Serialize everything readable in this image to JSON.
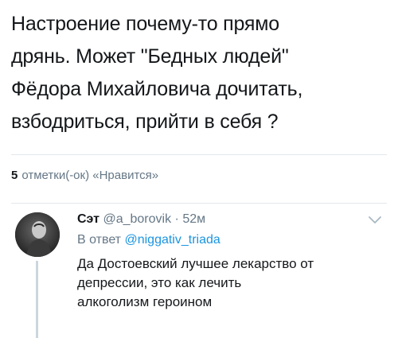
{
  "tweet": {
    "text_lines": [
      "Настроение почему-то прямо",
      "дрянь. Может \"Бедных людей\"",
      "Фёдора Михайловича дочитать,",
      "взбодриться, прийти в себя ?"
    ],
    "likes_count": "5",
    "likes_label": "отметки(-ок) «Нравится»"
  },
  "reply": {
    "author_name": "Сэт",
    "author_handle": "@a_borovik",
    "separator": "·",
    "time": "52м",
    "reply_to_prefix": "В ответ",
    "reply_to_handle": "@niggativ_triada",
    "text_lines": [
      "Да Достоевский лучшее лекарство от",
      "депрессии, это как лечить",
      "алкоголизм героином"
    ],
    "menu_icon": "chevron-down-icon"
  },
  "colors": {
    "text": "#14171a",
    "secondary": "#657786",
    "link": "#1b95e0",
    "divider": "#e1e8ed",
    "thread_line": "#ccd6dd"
  }
}
